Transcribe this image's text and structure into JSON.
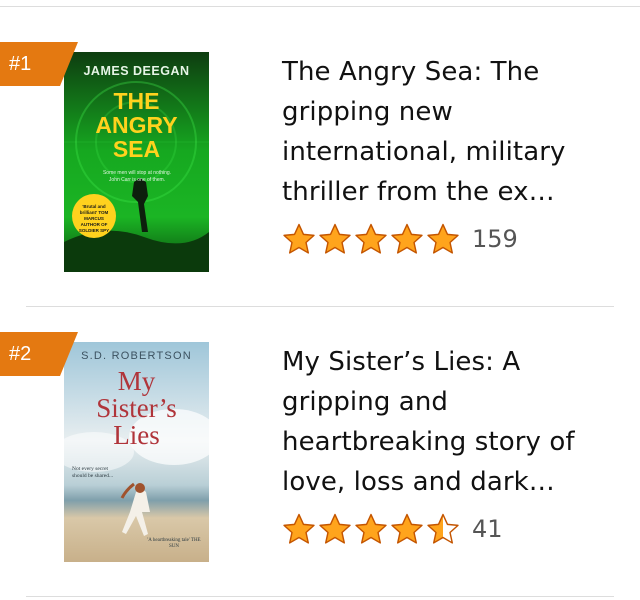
{
  "items": [
    {
      "rank": "#1",
      "title": "The Angry Sea: The gripping new international, military thriller from the ex…",
      "rating": 5,
      "review_count": "159",
      "cover": {
        "author": "JAMES DEEGAN",
        "title_line1": "THE",
        "title_line2": "ANGRY",
        "title_line3": "SEA",
        "tagline": "Some men will stop at nothing. John Carr is one of them.",
        "blurb": "'Brutal and brilliant' TOM MARCUS AUTHOR OF SOLDIER SPY"
      }
    },
    {
      "rank": "#2",
      "title": "My Sister’s Lies: A gripping and heartbreaking story of love, loss and dark…",
      "rating": 4.5,
      "review_count": "41",
      "cover": {
        "author": "S.D. ROBERTSON",
        "title_line1": "My",
        "title_line2": "Sister’s",
        "title_line3": "Lies",
        "tagline": "Not every secret should be shared...",
        "blurb": "'A heartbreaking tale' THE SUN"
      }
    }
  ],
  "colors": {
    "badge": "#e47911",
    "star": "#ffa41c",
    "star_outline": "#c45500"
  }
}
